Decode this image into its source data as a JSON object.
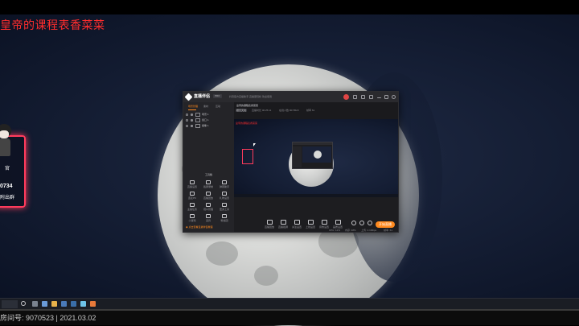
{
  "stream_overlay": {
    "title": "皇帝的课程表香菜菜",
    "card_line1": "官",
    "card_line2": "0734",
    "card_line3": "附出群"
  },
  "app": {
    "name": "直播伴侣",
    "version_badge": "PRO",
    "notice": "抖音官方直播助手·直播更轻松·欢迎使用",
    "sidebar_tabs": [
      "场景管理",
      "素材",
      "互动"
    ],
    "scenes": [
      "场景 1",
      "窗口 1",
      "摄像 1"
    ],
    "tools_header": "工具箱",
    "tools": [
      "直播设置",
      "截屏录制",
      "弹幕助手",
      "连麦PK",
      "直播回放",
      "礼物设置",
      "主播任务",
      "观众管理",
      "更多工具",
      "小游戏",
      "道具",
      "粉丝团"
    ],
    "sidebar_footer": "◉ 点击查看直播伴侣教程",
    "room_title": "皇帝的课程表香菜菜",
    "room_tag": "娱乐天地",
    "room_meta": [
      "直播时长 00:25:11",
      "在线人数 9070523",
      "帧率 61"
    ],
    "toolbar": [
      "直播回放",
      "直播截屏",
      "关注设置",
      "上线设置",
      "音效设置",
      "画质设置"
    ],
    "live_button": "开始直播",
    "status": [
      "CPU: 12%",
      "内存: 48%",
      "上传: 2.1Mbps",
      "帧率: 61"
    ]
  },
  "footer": {
    "room_info": "房间号: 9070523 | 2021.03.02"
  }
}
